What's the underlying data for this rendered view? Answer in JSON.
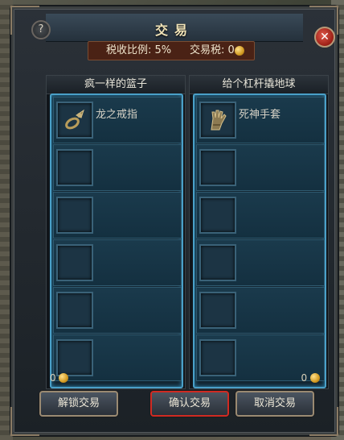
{
  "window": {
    "title": "交易",
    "help_symbol": "?",
    "close_symbol": "✕"
  },
  "tax": {
    "rate_label": "税收比例: 5%",
    "tax_label": "交易税: 0",
    "coin_icon": "gold-coin-icon"
  },
  "left_panel": {
    "player_name": "疯一样的篮子",
    "items": [
      {
        "name": "龙之戒指",
        "icon": "ring-icon"
      },
      {
        "name": ""
      },
      {
        "name": ""
      },
      {
        "name": ""
      },
      {
        "name": ""
      },
      {
        "name": ""
      }
    ],
    "gold": "0"
  },
  "right_panel": {
    "player_name": "给个杠杆撬地球",
    "items": [
      {
        "name": "死神手套",
        "icon": "glove-icon"
      },
      {
        "name": ""
      },
      {
        "name": ""
      },
      {
        "name": ""
      },
      {
        "name": ""
      },
      {
        "name": ""
      }
    ],
    "gold": "0"
  },
  "buttons": {
    "unlock": "解锁交易",
    "confirm": "确认交易",
    "cancel": "取消交易"
  },
  "colors": {
    "slot_border": "#4aa0c8",
    "confirm_highlight": "#d02a22",
    "tax_bar": "#4a2215"
  }
}
